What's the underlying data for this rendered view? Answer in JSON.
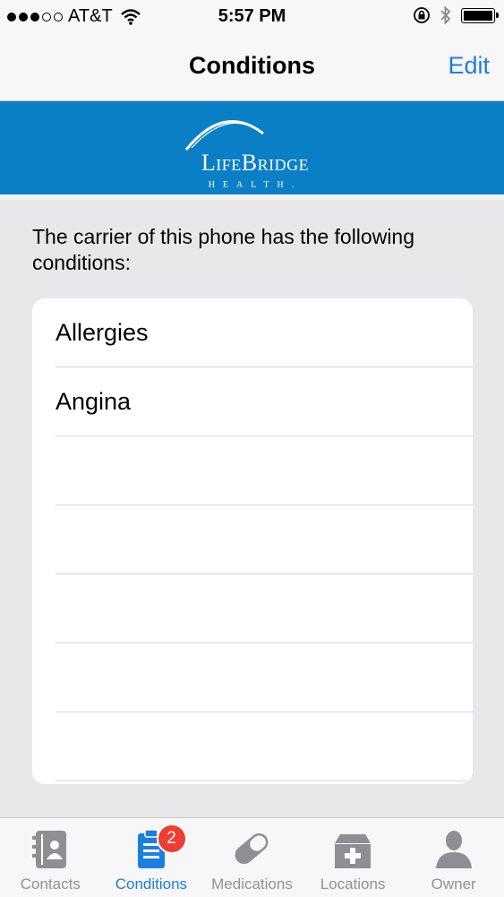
{
  "status": {
    "carrier": "AT&T",
    "time": "5:57 PM",
    "signal_bars_filled": 3,
    "signal_bars_total": 5
  },
  "nav": {
    "title": "Conditions",
    "edit_label": "Edit"
  },
  "banner": {
    "logo_text": "LifeBridge",
    "logo_sub": "HEALTH."
  },
  "intro_text": "The carrier of this phone has the following conditions:",
  "conditions": [
    "Allergies",
    "Angina",
    "",
    "",
    "",
    "",
    ""
  ],
  "tabs": [
    {
      "label": "Contacts",
      "icon": "contacts-book-icon",
      "active": false
    },
    {
      "label": "Conditions",
      "icon": "clipboard-icon",
      "active": true,
      "badge": "2"
    },
    {
      "label": "Medications",
      "icon": "pill-icon",
      "active": false
    },
    {
      "label": "Locations",
      "icon": "medical-box-icon",
      "active": false
    },
    {
      "label": "Owner",
      "icon": "person-icon",
      "active": false
    }
  ],
  "colors": {
    "accent": "#1b7fe0",
    "banner": "#0a7fc6",
    "badge": "#f03c35",
    "inactive_tab": "#929292"
  }
}
